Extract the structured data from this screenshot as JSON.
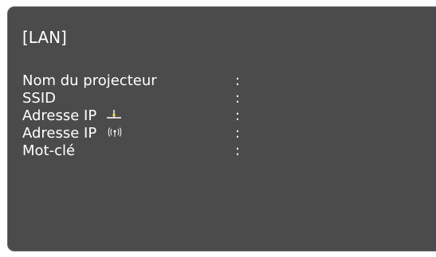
{
  "window": {
    "title": "[LAN]"
  },
  "rows": [
    {
      "label": "Nom du projecteur",
      "separator": ":",
      "value": ""
    },
    {
      "label": "SSID",
      "separator": ":",
      "value": ""
    },
    {
      "label": "Adresse IP",
      "icon": "wired-lan-icon",
      "separator": ":",
      "value": ""
    },
    {
      "label": "Adresse IP",
      "icon": "wireless-lan-icon",
      "separator": ":",
      "value": ""
    },
    {
      "label": "Mot-clé",
      "separator": ":",
      "value": ""
    }
  ],
  "colors": {
    "screen_background": "#4b4b4b",
    "text": "#ffffff",
    "wired_icon_dot": "#f2d33a"
  }
}
